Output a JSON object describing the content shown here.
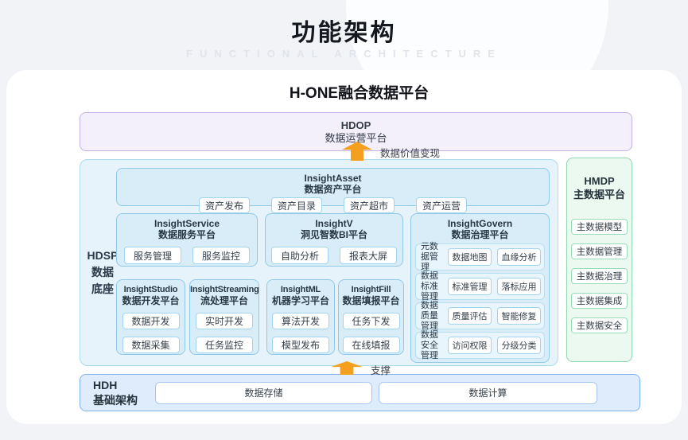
{
  "header": {
    "title": "功能架构",
    "subtitle": "FUNCTIONAL ARCHITECTURE"
  },
  "diagram": {
    "title": "H-ONE融合数据平台",
    "hdop": {
      "code": "HDOP",
      "name": "数据运营平台",
      "arrow_label": "数据价值变现"
    },
    "hdsp": {
      "code": "HDSP",
      "name_line1": "数据",
      "name_line2": "底座",
      "asset": {
        "code": "InsightAsset",
        "name": "数据资产平台",
        "items": [
          "资产发布",
          "资产目录",
          "资产超市",
          "资产运营"
        ]
      },
      "service": {
        "code": "InsightService",
        "name": "数据服务平台",
        "items": [
          "服务管理",
          "服务监控"
        ]
      },
      "bi": {
        "code": "InsightV",
        "name": "洞见智数BI平台",
        "items": [
          "自助分析",
          "报表大屏"
        ]
      },
      "govern": {
        "code": "InsightGovern",
        "name": "数据治理平台",
        "rows": [
          {
            "label": "元数据管理",
            "items": [
              "数据地图",
              "血缘分析"
            ]
          },
          {
            "label": "数据标准管理",
            "items": [
              "标准管理",
              "落标应用"
            ]
          },
          {
            "label": "数据质量管理",
            "items": [
              "质量评估",
              "智能修复"
            ]
          },
          {
            "label": "数据安全管理",
            "items": [
              "访问权限",
              "分级分类"
            ]
          }
        ]
      },
      "studio": {
        "code": "InsightStudio",
        "name": "数据开发平台",
        "items": [
          "数据开发",
          "数据采集"
        ]
      },
      "streaming": {
        "code": "InsightStreaming",
        "name": "流处理平台",
        "items": [
          "实时开发",
          "任务监控"
        ]
      },
      "ml": {
        "code": "InsightML",
        "name": "机器学习平台",
        "items": [
          "算法开发",
          "模型发布"
        ]
      },
      "fill": {
        "code": "InsightFill",
        "name": "数据填报平台",
        "items": [
          "任务下发",
          "在线填报"
        ]
      }
    },
    "hmdp": {
      "code": "HMDP",
      "name": "主数据平台",
      "items": [
        "主数据模型",
        "主数据管理",
        "主数据治理",
        "主数据集成",
        "主数据安全"
      ]
    },
    "hdh": {
      "code": "HDH",
      "name": "基础架构",
      "arrow_label": "支撑",
      "items": [
        "数据存储",
        "数据计算"
      ]
    },
    "colors": {
      "accent_orange": "#F59F1E",
      "hdop_border": "#C6B2E8",
      "hdsp_border": "#ABDCEA",
      "inner_border": "#8FC9EA",
      "hmdp_border": "#8FD9B2",
      "hdh_border": "#7FB2EF"
    }
  }
}
